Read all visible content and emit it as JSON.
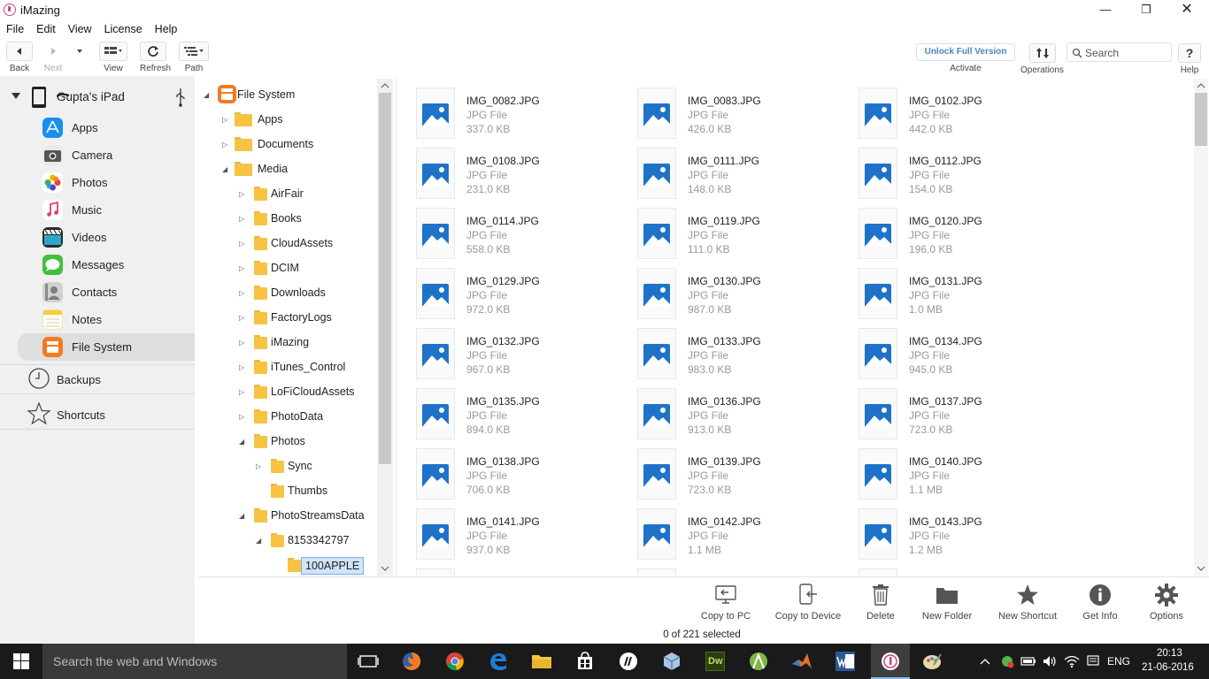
{
  "window": {
    "title": "iMazing"
  },
  "menu": [
    "File",
    "Edit",
    "View",
    "License",
    "Help"
  ],
  "toolbar": {
    "back": "Back",
    "next": "Next",
    "view": "View",
    "refresh": "Refresh",
    "path": "Path",
    "unlock": "Unlock Full Version",
    "activate": "Activate",
    "operations": "Operations",
    "search_placeholder": "Search",
    "help": "Help"
  },
  "sidebar": {
    "device": "Gupta's iPad",
    "items": [
      {
        "label": "Apps",
        "icon": "apps-icon",
        "color": "#1b8ef1"
      },
      {
        "label": "Camera",
        "icon": "camera-icon",
        "color": "#555555"
      },
      {
        "label": "Photos",
        "icon": "photos-icon",
        "color": "#ffffff"
      },
      {
        "label": "Music",
        "icon": "music-icon",
        "color": "#ffffff"
      },
      {
        "label": "Videos",
        "icon": "videos-icon",
        "color": "#333333"
      },
      {
        "label": "Messages",
        "icon": "messages-icon",
        "color": "#3fc03f"
      },
      {
        "label": "Contacts",
        "icon": "contacts-icon",
        "color": "#9a9a9a"
      },
      {
        "label": "Notes",
        "icon": "notes-icon",
        "color": "#ffe27a"
      },
      {
        "label": "File System",
        "icon": "file-system-icon",
        "color": "#f47a20"
      }
    ],
    "backups": "Backups",
    "shortcuts": "Shortcuts"
  },
  "tree": [
    {
      "label": "File System",
      "depth": 0,
      "state": "open",
      "kind": "root"
    },
    {
      "label": "Apps",
      "depth": 1,
      "state": "closed",
      "kind": "folder-big"
    },
    {
      "label": "Documents",
      "depth": 1,
      "state": "closed",
      "kind": "folder-big"
    },
    {
      "label": "Media",
      "depth": 1,
      "state": "open",
      "kind": "folder-big"
    },
    {
      "label": "AirFair",
      "depth": 2,
      "state": "closed",
      "kind": "folder"
    },
    {
      "label": "Books",
      "depth": 2,
      "state": "closed",
      "kind": "folder"
    },
    {
      "label": "CloudAssets",
      "depth": 2,
      "state": "closed",
      "kind": "folder"
    },
    {
      "label": "DCIM",
      "depth": 2,
      "state": "closed",
      "kind": "folder"
    },
    {
      "label": "Downloads",
      "depth": 2,
      "state": "closed",
      "kind": "folder"
    },
    {
      "label": "FactoryLogs",
      "depth": 2,
      "state": "closed",
      "kind": "folder"
    },
    {
      "label": "iMazing",
      "depth": 2,
      "state": "closed",
      "kind": "folder"
    },
    {
      "label": "iTunes_Control",
      "depth": 2,
      "state": "closed",
      "kind": "folder"
    },
    {
      "label": "LoFiCloudAssets",
      "depth": 2,
      "state": "closed",
      "kind": "folder"
    },
    {
      "label": "PhotoData",
      "depth": 2,
      "state": "closed",
      "kind": "folder"
    },
    {
      "label": "Photos",
      "depth": 2,
      "state": "open",
      "kind": "folder"
    },
    {
      "label": "Sync",
      "depth": 3,
      "state": "closed",
      "kind": "folder"
    },
    {
      "label": "Thumbs",
      "depth": 3,
      "state": "none",
      "kind": "folder"
    },
    {
      "label": "PhotoStreamsData",
      "depth": 2,
      "state": "open",
      "kind": "folder"
    },
    {
      "label": "8153342797",
      "depth": 3,
      "state": "open",
      "kind": "folder"
    },
    {
      "label": "100APPLE",
      "depth": 4,
      "state": "none",
      "kind": "folder",
      "selected": true
    }
  ],
  "files": [
    {
      "name": "IMG_0082.JPG",
      "type": "JPG File",
      "size": "337.0 KB"
    },
    {
      "name": "IMG_0083.JPG",
      "type": "JPG File",
      "size": "426.0 KB"
    },
    {
      "name": "IMG_0102.JPG",
      "type": "JPG File",
      "size": "442.0 KB"
    },
    {
      "name": "IMG_0108.JPG",
      "type": "JPG File",
      "size": "231.0 KB"
    },
    {
      "name": "IMG_0111.JPG",
      "type": "JPG File",
      "size": "148.0 KB"
    },
    {
      "name": "IMG_0112.JPG",
      "type": "JPG File",
      "size": "154.0 KB"
    },
    {
      "name": "IMG_0114.JPG",
      "type": "JPG File",
      "size": "558.0 KB"
    },
    {
      "name": "IMG_0119.JPG",
      "type": "JPG File",
      "size": "111.0 KB"
    },
    {
      "name": "IMG_0120.JPG",
      "type": "JPG File",
      "size": "196.0 KB"
    },
    {
      "name": "IMG_0129.JPG",
      "type": "JPG File",
      "size": "972.0 KB"
    },
    {
      "name": "IMG_0130.JPG",
      "type": "JPG File",
      "size": "987.0 KB"
    },
    {
      "name": "IMG_0131.JPG",
      "type": "JPG File",
      "size": "1.0 MB"
    },
    {
      "name": "IMG_0132.JPG",
      "type": "JPG File",
      "size": "967.0 KB"
    },
    {
      "name": "IMG_0133.JPG",
      "type": "JPG File",
      "size": "983.0 KB"
    },
    {
      "name": "IMG_0134.JPG",
      "type": "JPG File",
      "size": "945.0 KB"
    },
    {
      "name": "IMG_0135.JPG",
      "type": "JPG File",
      "size": "894.0 KB"
    },
    {
      "name": "IMG_0136.JPG",
      "type": "JPG File",
      "size": "913.0 KB"
    },
    {
      "name": "IMG_0137.JPG",
      "type": "JPG File",
      "size": "723.0 KB"
    },
    {
      "name": "IMG_0138.JPG",
      "type": "JPG File",
      "size": "706.0 KB"
    },
    {
      "name": "IMG_0139.JPG",
      "type": "JPG File",
      "size": "723.0 KB"
    },
    {
      "name": "IMG_0140.JPG",
      "type": "JPG File",
      "size": "1.1 MB"
    },
    {
      "name": "IMG_0141.JPG",
      "type": "JPG File",
      "size": "937.0 KB"
    },
    {
      "name": "IMG_0142.JPG",
      "type": "JPG File",
      "size": "1.1 MB"
    },
    {
      "name": "IMG_0143.JPG",
      "type": "JPG File",
      "size": "1.2 MB"
    }
  ],
  "actions": [
    {
      "label": "Copy to PC",
      "icon": "copy-to-pc-icon"
    },
    {
      "label": "Copy to Device",
      "icon": "copy-to-device-icon"
    },
    {
      "label": "Delete",
      "icon": "trash-icon"
    },
    {
      "label": "New Folder",
      "icon": "folder-icon"
    },
    {
      "label": "New Shortcut",
      "icon": "star-icon"
    },
    {
      "label": "Get Info",
      "icon": "info-icon"
    },
    {
      "label": "Options",
      "icon": "gear-icon"
    }
  ],
  "status": "0 of 221 selected",
  "taskbar": {
    "search_placeholder": "Search the web and Windows",
    "lang": "ENG",
    "time": "20:13",
    "date": "21-06-2016"
  }
}
